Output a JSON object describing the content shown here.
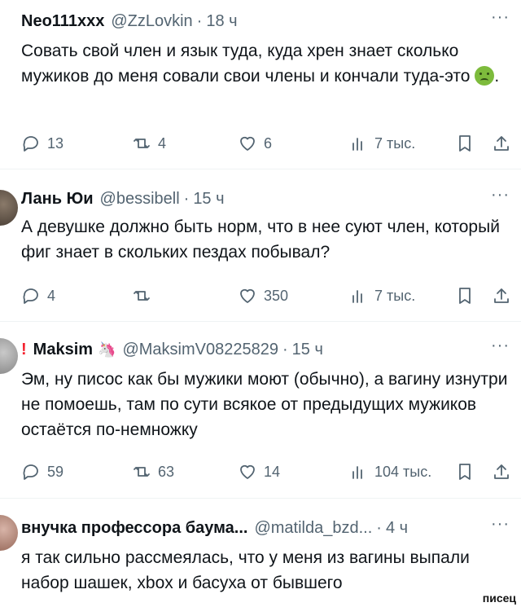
{
  "tweets": [
    {
      "name": "Neo111xxx",
      "handle": "@ZzLovkin",
      "dot": "·",
      "time": "18 ч",
      "more": "···",
      "text": "Совать свой член и язык туда, куда хрен знает сколько мужиков до меня совали свои члены и кончали туда-это",
      "text_end": ".",
      "emoji": "nauseated-face-emoji",
      "replies": "13",
      "retweets": "4",
      "likes": "6",
      "views": "7 тыс."
    },
    {
      "name": "Лань Юи",
      "handle": "@bessibell",
      "dot": "·",
      "time": "15 ч",
      "more": "···",
      "text": "А девушке должно быть норм, что в нее суют член, который фиг знает в скольких пездах побывал?",
      "replies": "4",
      "retweets": "",
      "likes": "350",
      "views": "7 тыс."
    },
    {
      "name": "Maksim",
      "mark": "!",
      "badge": "unicorn-icon",
      "handle": "@MaksimV08225829",
      "dot": "·",
      "time": "15 ч",
      "more": "···",
      "text": "Эм, ну писос как бы мужики моют (обычно), а вагину изнутри не помоешь, там по сути всякое от предыдущих мужиков остаётся по-немножку",
      "replies": "59",
      "retweets": "63",
      "likes": "14",
      "views": "104 тыс."
    },
    {
      "name": "внучка профессора баума...",
      "handle": "@matilda_bzd...",
      "dot": "·",
      "time": "4 ч",
      "more": "···",
      "text": "я так сильно рассмеялась, что у меня из вагины выпали набор шашек, xbox и басуха от бывшего"
    }
  ],
  "watermark": "писец"
}
